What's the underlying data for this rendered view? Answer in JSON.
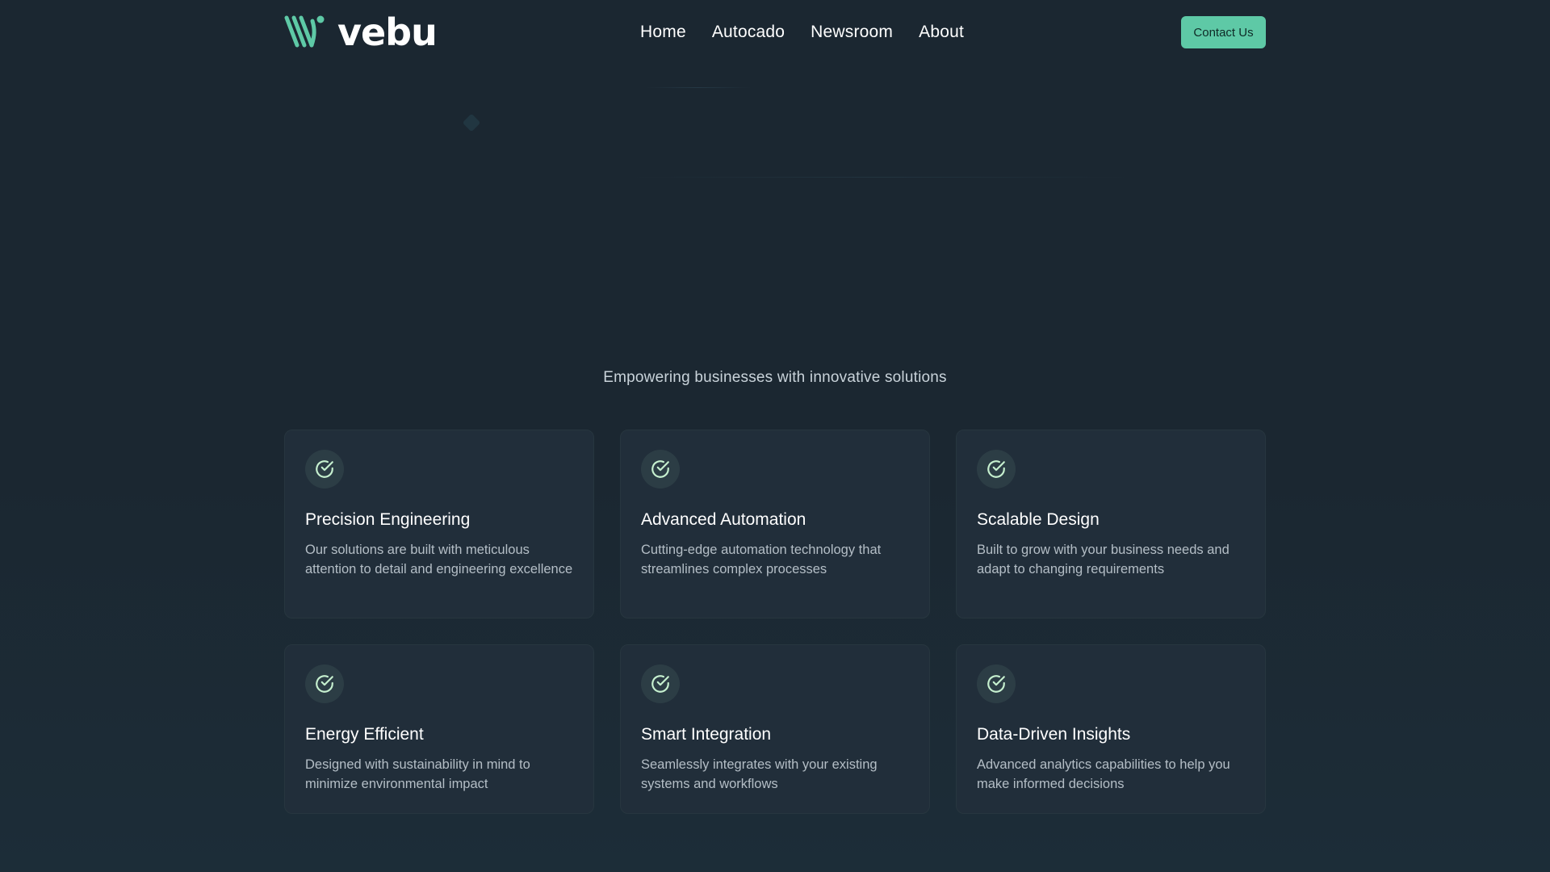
{
  "brand": {
    "name": "vebu",
    "accent": "#5ec9a6"
  },
  "nav": {
    "links": [
      "Home",
      "Autocado",
      "Newsroom",
      "About"
    ],
    "cta": "Contact Us"
  },
  "hero": {
    "tagline": "Empowering businesses with innovative solutions"
  },
  "features": [
    {
      "icon": "check-circle-icon",
      "title": "Precision Engineering",
      "description": "Our solutions are built with meticulous attention to detail and engineering excellence"
    },
    {
      "icon": "check-circle-icon",
      "title": "Advanced Automation",
      "description": "Cutting-edge automation technology that streamlines complex processes"
    },
    {
      "icon": "check-circle-icon",
      "title": "Scalable Design",
      "description": "Built to grow with your business needs and adapt to changing requirements"
    },
    {
      "icon": "check-circle-icon",
      "title": "Energy Efficient",
      "description": "Designed with sustainability in mind to minimize environmental impact"
    },
    {
      "icon": "check-circle-icon",
      "title": "Smart Integration",
      "description": "Seamlessly integrates with your existing systems and workflows"
    },
    {
      "icon": "check-circle-icon",
      "title": "Data-Driven Insights",
      "description": "Advanced analytics capabilities to help you make informed decisions"
    }
  ]
}
